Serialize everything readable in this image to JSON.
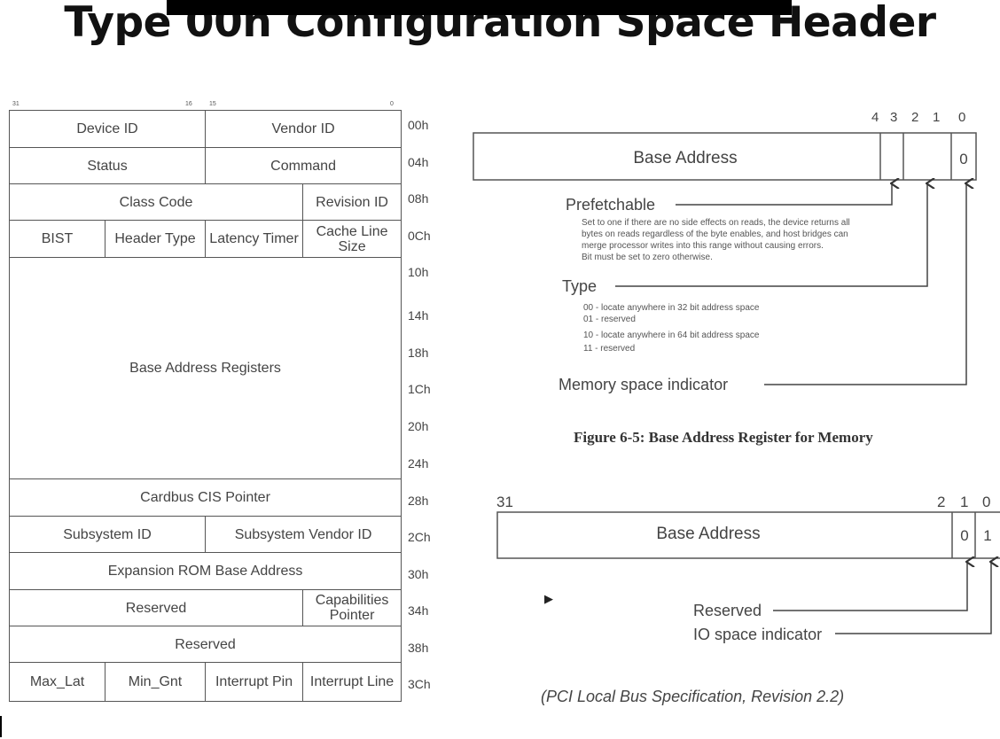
{
  "title": "Type 00h Configuration Space Header",
  "bit_labels": {
    "b31": "31",
    "b16": "16",
    "b15": "15",
    "b0": "0"
  },
  "header_table": {
    "rows": [
      [
        {
          "text": "Device ID",
          "span": 4
        },
        {
          "text": "Vendor ID",
          "span": 4
        }
      ],
      [
        {
          "text": "Status",
          "span": 4
        },
        {
          "text": "Command",
          "span": 4
        }
      ],
      [
        {
          "text": "Class Code",
          "span": 6
        },
        {
          "text": "Revision ID",
          "span": 2
        }
      ],
      [
        {
          "text": "BIST",
          "span": 2
        },
        {
          "text": "Header Type",
          "span": 2
        },
        {
          "text": "Latency Timer",
          "span": 2
        },
        {
          "text": "Cache Line Size",
          "span": 2
        }
      ],
      [
        {
          "text": "Base Address Registers",
          "span": 8
        }
      ],
      [
        {
          "text": "Cardbus CIS Pointer",
          "span": 8
        }
      ],
      [
        {
          "text": "Subsystem ID",
          "span": 4
        },
        {
          "text": "Subsystem Vendor ID",
          "span": 4
        }
      ],
      [
        {
          "text": "Expansion ROM Base Address",
          "span": 8
        }
      ],
      [
        {
          "text": "Reserved",
          "span": 6
        },
        {
          "text": "Capabilities Pointer",
          "span": 2
        }
      ],
      [
        {
          "text": "Reserved",
          "span": 8
        }
      ],
      [
        {
          "text": "Max_Lat",
          "span": 2
        },
        {
          "text": "Min_Gnt",
          "span": 2
        },
        {
          "text": "Interrupt Pin",
          "span": 2
        },
        {
          "text": "Interrupt Line",
          "span": 2
        }
      ]
    ],
    "offsets": [
      "00h",
      "04h",
      "08h",
      "0Ch",
      "10h",
      "14h",
      "18h",
      "1Ch",
      "20h",
      "24h",
      "28h",
      "2Ch",
      "30h",
      "34h",
      "38h",
      "3Ch"
    ]
  },
  "memory_bar": {
    "bit_numbers": [
      "4",
      "3",
      "2",
      "1",
      "0"
    ],
    "field_label": "Base Address",
    "bit0_value": "0",
    "prefetchable_label": "Prefetchable",
    "prefetchable_desc": [
      "Set to one if there are no side effects on reads, the device returns all",
      "bytes on reads regardless of the byte enables, and host bridges can",
      "merge processor writes into this range without causing errors.",
      "Bit must be set to zero otherwise."
    ],
    "type_label": "Type",
    "type_desc": [
      "00 - locate anywhere in 32 bit address space",
      "01 - reserved",
      "10 - locate anywhere in 64 bit address space",
      "11 - reserved"
    ],
    "memory_indicator_label": "Memory space indicator",
    "caption": "Figure 6-5:  Base Address Register for Memory"
  },
  "io_bar": {
    "bit_31": "31",
    "bit_numbers": [
      "2",
      "1",
      "0"
    ],
    "field_label": "Base Address",
    "bit1_value": "0",
    "bit0_value": "1",
    "reserved_label": "Reserved",
    "io_indicator_label": "IO space indicator"
  },
  "citation": "(PCI Local Bus Specification, Revision 2.2)"
}
